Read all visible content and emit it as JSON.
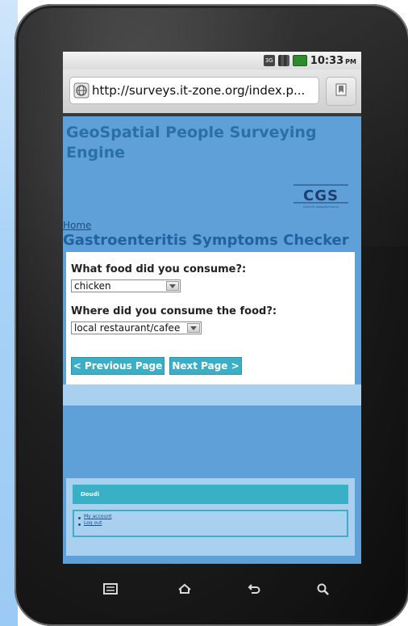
{
  "status_bar": {
    "time": "10:33",
    "ampm": "PM",
    "icons": [
      "3g-icon",
      "signal-icon",
      "battery-icon"
    ]
  },
  "browser": {
    "url": "http://surveys.it-zone.org/index.p..."
  },
  "site": {
    "title": "GeoSpatial People Surveying Engine",
    "logo_text": "CGS",
    "logo_subtext": "Centre for Geospatial Science",
    "breadcrumb_home": "Home",
    "page_heading": "Gastroenteritis Symptoms Checker"
  },
  "form": {
    "q1_label": "What food did you consume?:",
    "q1_value": "chicken",
    "q2_label": "Where did you consume the food?:",
    "q2_value": "local restaurant/cafee",
    "prev_button": "< Previous Page",
    "next_button": "Next Page >"
  },
  "footer": {
    "username": "Doudi",
    "links": [
      "My account",
      "Log out"
    ]
  },
  "colors": {
    "page_bg": "#5fa0d8",
    "accent": "#3ab0c7",
    "title": "#2a6fa8",
    "heading": "#2361a0"
  },
  "nav_keys": [
    "menu-icon",
    "home-icon",
    "back-icon",
    "search-icon"
  ]
}
